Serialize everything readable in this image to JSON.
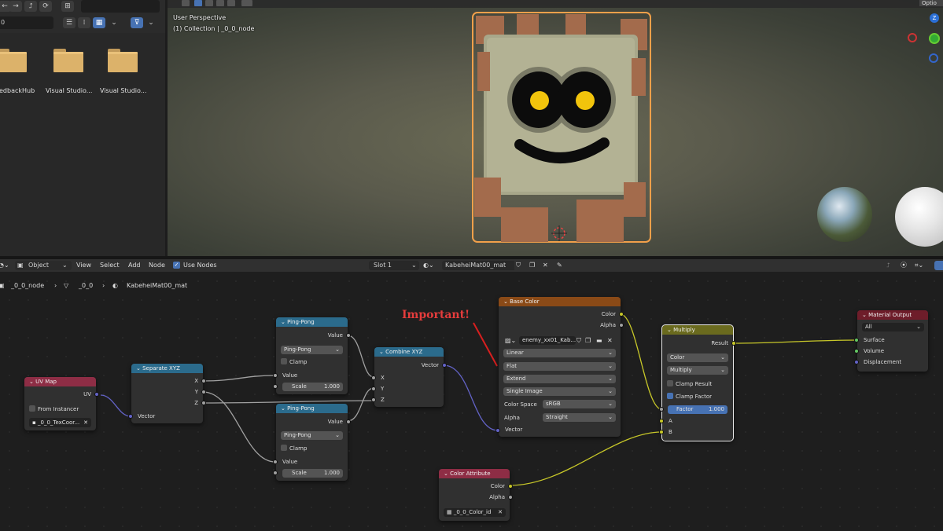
{
  "file_browser": {
    "path_field": "0",
    "folders": [
      {
        "label": "edbackHub"
      },
      {
        "label": "Visual Studio..."
      },
      {
        "label": "Visual Studio..."
      }
    ]
  },
  "viewport": {
    "perspective": "User Perspective",
    "collection": "(1) Collection | _0_0_node",
    "options_label": "Optio"
  },
  "node_editor": {
    "header": {
      "mode": "Object",
      "menus": [
        "View",
        "Select",
        "Add",
        "Node"
      ],
      "use_nodes": "Use Nodes",
      "slot": "Slot 1",
      "material": "KabeheiMat00_mat"
    },
    "breadcrumb": {
      "object": "_0_0_node",
      "mesh": "_0_0",
      "material": "KabeheiMat00_mat"
    }
  },
  "annotation": {
    "text": "Important!",
    "color": "#e43c3c"
  },
  "nodes": {
    "uv_map": {
      "title": "UV Map",
      "output": "UV",
      "from_instancer": "From Instancer",
      "map": "_0_0_TexCoor...",
      "color": "#8e2d45"
    },
    "separate_xyz": {
      "title": "Separate XYZ",
      "outputs": [
        "X",
        "Y",
        "Z"
      ],
      "input": "Vector",
      "color": "#2b6b8c"
    },
    "ping_pong_1": {
      "title": "Ping-Pong",
      "output": "Value",
      "op": "Ping-Pong",
      "clamp": "Clamp",
      "input": "Value",
      "scale_label": "Scale",
      "scale_value": "1.000"
    },
    "ping_pong_2": {
      "title": "Ping-Pong",
      "output": "Value",
      "op": "Ping-Pong",
      "clamp": "Clamp",
      "input": "Value",
      "scale_label": "Scale",
      "scale_value": "1.000"
    },
    "combine_xyz": {
      "title": "Combine XYZ",
      "output": "Vector",
      "inputs": [
        "X",
        "Y",
        "Z"
      ]
    },
    "base_color": {
      "title": "Base Color",
      "outputs": [
        "Color",
        "Alpha"
      ],
      "image": "enemy_xx01_Kab...",
      "interpolation": "Linear",
      "projection": "Flat",
      "extension": "Extend",
      "source": "Single Image",
      "color_space_label": "Color Space",
      "color_space": "sRGB",
      "alpha_label": "Alpha",
      "alpha_mode": "Straight",
      "input": "Vector",
      "color": "#8a4a17"
    },
    "multiply": {
      "title": "Multiply",
      "output": "Result",
      "type": "Color",
      "blend": "Multiply",
      "clamp_result": "Clamp Result",
      "clamp_factor": "Clamp Factor",
      "factor_label": "Factor",
      "factor_value": "1.000",
      "inputs": [
        "A",
        "B"
      ],
      "color": "#6a6a1e"
    },
    "material_output": {
      "title": "Material Output",
      "target": "All",
      "inputs": [
        "Surface",
        "Volume",
        "Displacement"
      ],
      "color": "#6e1d2a"
    },
    "color_attribute": {
      "title": "Color Attribute",
      "outputs": [
        "Color",
        "Alpha"
      ],
      "layer": "_0_0_Color_id"
    }
  }
}
